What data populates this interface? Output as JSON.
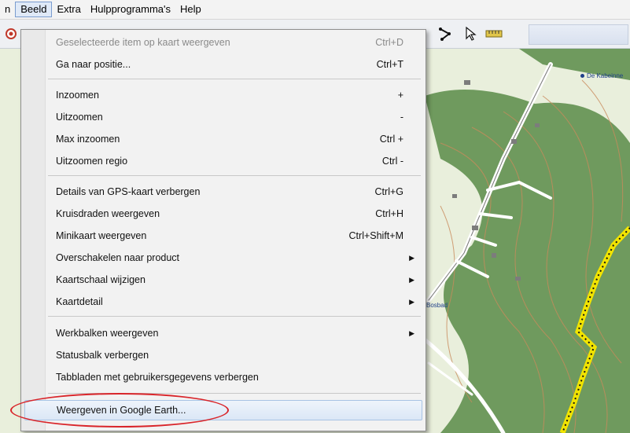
{
  "menubar": {
    "items": [
      {
        "label": "n",
        "open": false
      },
      {
        "label": "Beeld",
        "open": true
      },
      {
        "label": "Extra",
        "open": false
      },
      {
        "label": "Hulpprogramma's",
        "open": false
      },
      {
        "label": "Help",
        "open": false
      }
    ]
  },
  "map": {
    "labels": [
      "De Kabeinne",
      "Bosbad"
    ]
  },
  "menu": {
    "items": [
      {
        "label": "Geselecteerde item op kaart weergeven",
        "shortcut": "Ctrl+D",
        "disabled": true
      },
      {
        "label": "Ga naar positie...",
        "shortcut": "Ctrl+T"
      },
      {
        "label": "Inzoomen",
        "shortcut": "+"
      },
      {
        "label": "Uitzoomen",
        "shortcut": "-"
      },
      {
        "label": "Max inzoomen",
        "shortcut": "Ctrl +"
      },
      {
        "label": "Uitzoomen regio",
        "shortcut": "Ctrl -"
      },
      {
        "label": "Details van GPS-kaart verbergen",
        "shortcut": "Ctrl+G"
      },
      {
        "label": "Kruisdraden weergeven",
        "shortcut": "Ctrl+H"
      },
      {
        "label": "Minikaart weergeven",
        "shortcut": "Ctrl+Shift+M"
      },
      {
        "label": "Overschakelen naar product",
        "submenu": true
      },
      {
        "label": "Kaartschaal wijzigen",
        "submenu": true
      },
      {
        "label": "Kaartdetail",
        "submenu": true
      },
      {
        "label": "Werkbalken weergeven",
        "submenu": true
      },
      {
        "label": "Statusbalk verbergen"
      },
      {
        "label": "Tabbladen met gebruikersgegevens verbergen"
      },
      {
        "label": "Weergeven in Google Earth...",
        "highlighted": true
      }
    ]
  },
  "colors": {
    "route": "#f2e400",
    "highlight_ellipse": "#d9252a",
    "forest": "#6f9a5e",
    "contour": "#c98a5c"
  }
}
